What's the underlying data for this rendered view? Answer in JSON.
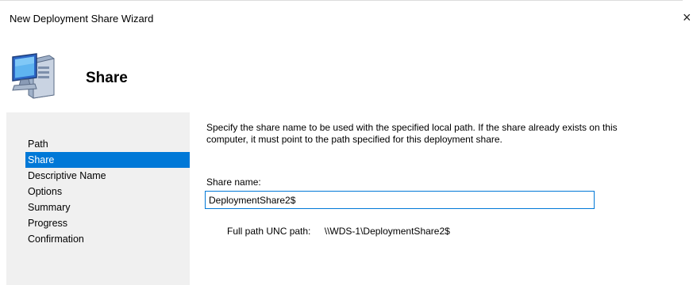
{
  "window": {
    "title": "New Deployment Share Wizard",
    "close_glyph": "×"
  },
  "header": {
    "heading": "Share",
    "icon": "computer-icon"
  },
  "nav": {
    "items": [
      {
        "label": "Path",
        "selected": false
      },
      {
        "label": "Share",
        "selected": true
      },
      {
        "label": "Descriptive Name",
        "selected": false
      },
      {
        "label": "Options",
        "selected": false
      },
      {
        "label": "Summary",
        "selected": false
      },
      {
        "label": "Progress",
        "selected": false
      },
      {
        "label": "Confirmation",
        "selected": false
      }
    ]
  },
  "main": {
    "intro_line1": "Specify the share name to be used with the specified local path.  If the share already exists on this",
    "intro_line2": "computer, it must point to the path specified for this deployment share.",
    "share_label": "Share name:",
    "share_value": "DeploymentShare2$",
    "unc_label": "Full path UNC path:",
    "unc_value": "\\\\WDS-1\\DeploymentShare2$"
  },
  "colors": {
    "selection": "#0078d7",
    "nav_background": "#f0f0f0"
  }
}
